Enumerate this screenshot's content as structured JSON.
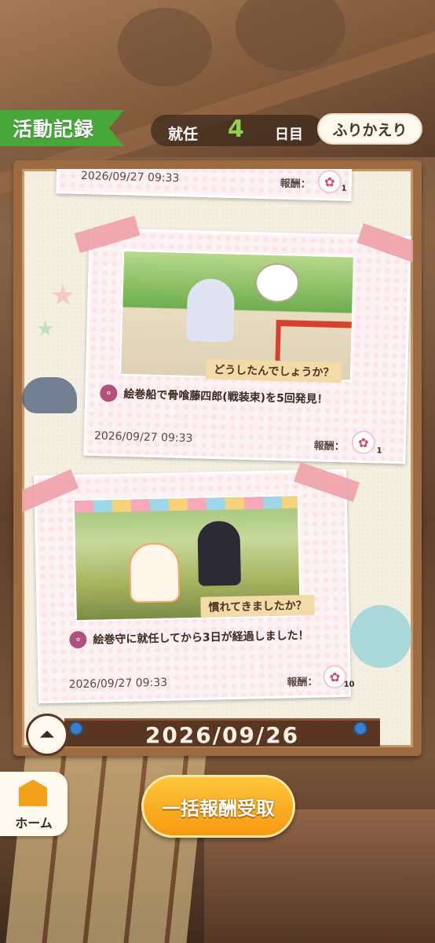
{
  "header": {
    "title": "活動記録",
    "day_label": "就任",
    "day_count": "4",
    "day_suffix": "日目",
    "review_button": "ふりかえり"
  },
  "records": [
    {
      "date": "2026/09/27 09:33",
      "reward_label": "報酬：",
      "reward_qty": "1"
    },
    {
      "speech": "どうしたんでしょうか？",
      "description": "絵巻船で骨喰藤四郎(戦装束)を5回発見！",
      "date": "2026/09/27 09:33",
      "reward_label": "報酬：",
      "reward_qty": "1"
    },
    {
      "speech": "慣れてきましたか？",
      "description": "絵巻守に就任してから3日が経過しました！",
      "date": "2026/09/27 09:33",
      "reward_label": "報酬：",
      "reward_qty": "10"
    }
  ],
  "date_divider": "2026/09/26",
  "footer": {
    "home_label": "ホーム",
    "claim_all_button": "一括報酬受取"
  },
  "icons": {
    "dango": "dango-icon",
    "reward": "flower-reward-icon",
    "scroll_top": "scroll-top-icon",
    "home": "castle-home-icon"
  },
  "colors": {
    "title_green": "#47a83a",
    "day_green": "#8fd14f",
    "claim_orange": "#f59a10",
    "frame_brown": "#9c6b42"
  }
}
